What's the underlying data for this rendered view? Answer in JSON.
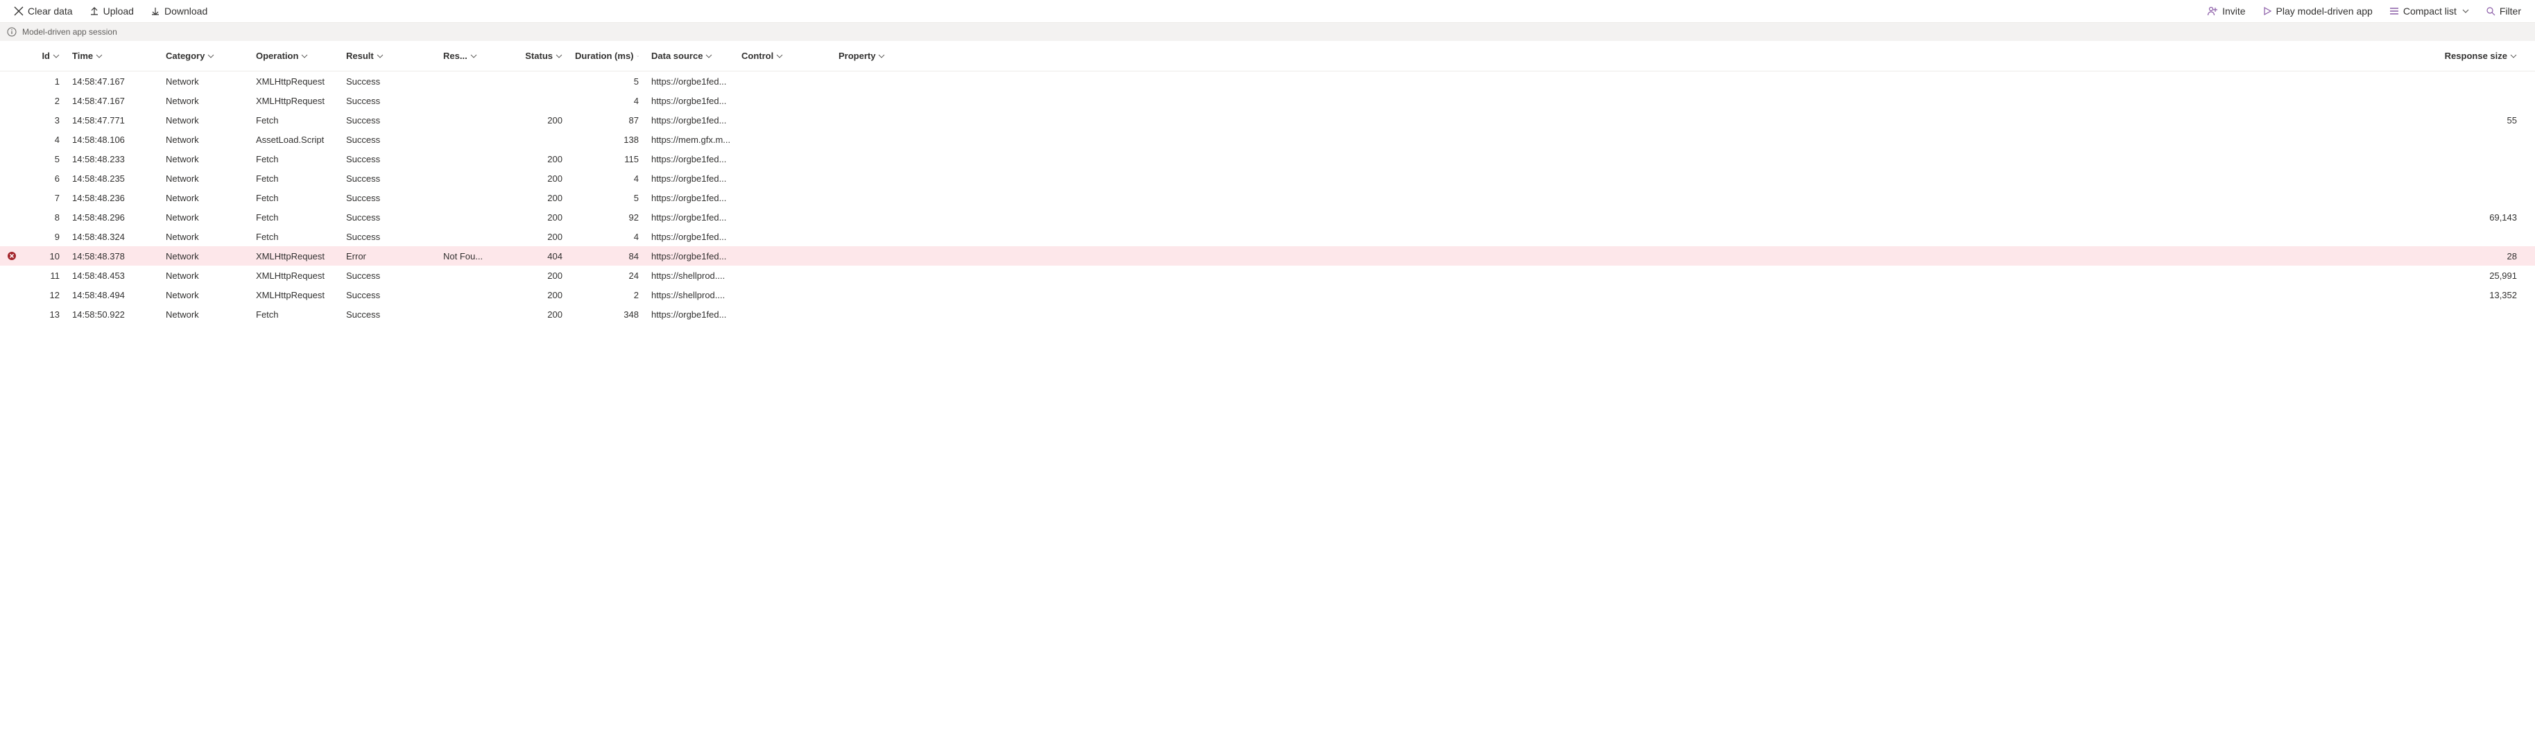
{
  "toolbar": {
    "left": {
      "clear_data": "Clear data",
      "upload": "Upload",
      "download": "Download"
    },
    "right": {
      "invite": "Invite",
      "play": "Play model-driven app",
      "compact_list": "Compact list",
      "filter": "Filter"
    }
  },
  "session_bar": {
    "label": "Model-driven app session"
  },
  "columns": {
    "id": "Id",
    "time": "Time",
    "category": "Category",
    "operation": "Operation",
    "result": "Result",
    "res": "Res...",
    "status": "Status",
    "duration": "Duration (ms)",
    "data_source": "Data source",
    "control": "Control",
    "property": "Property",
    "response_size": "Response size"
  },
  "rows": [
    {
      "id": "1",
      "time": "14:58:47.167",
      "category": "Network",
      "operation": "XMLHttpRequest",
      "result": "Success",
      "res": "",
      "status": "",
      "duration": "5",
      "data_source": "https://orgbe1fed...",
      "control": "",
      "property": "",
      "response_size": "",
      "error": false
    },
    {
      "id": "2",
      "time": "14:58:47.167",
      "category": "Network",
      "operation": "XMLHttpRequest",
      "result": "Success",
      "res": "",
      "status": "",
      "duration": "4",
      "data_source": "https://orgbe1fed...",
      "control": "",
      "property": "",
      "response_size": "",
      "error": false
    },
    {
      "id": "3",
      "time": "14:58:47.771",
      "category": "Network",
      "operation": "Fetch",
      "result": "Success",
      "res": "",
      "status": "200",
      "duration": "87",
      "data_source": "https://orgbe1fed...",
      "control": "",
      "property": "",
      "response_size": "55",
      "error": false
    },
    {
      "id": "4",
      "time": "14:58:48.106",
      "category": "Network",
      "operation": "AssetLoad.Script",
      "result": "Success",
      "res": "",
      "status": "",
      "duration": "138",
      "data_source": "https://mem.gfx.m...",
      "control": "",
      "property": "",
      "response_size": "",
      "error": false
    },
    {
      "id": "5",
      "time": "14:58:48.233",
      "category": "Network",
      "operation": "Fetch",
      "result": "Success",
      "res": "",
      "status": "200",
      "duration": "115",
      "data_source": "https://orgbe1fed...",
      "control": "",
      "property": "",
      "response_size": "",
      "error": false
    },
    {
      "id": "6",
      "time": "14:58:48.235",
      "category": "Network",
      "operation": "Fetch",
      "result": "Success",
      "res": "",
      "status": "200",
      "duration": "4",
      "data_source": "https://orgbe1fed...",
      "control": "",
      "property": "",
      "response_size": "",
      "error": false
    },
    {
      "id": "7",
      "time": "14:58:48.236",
      "category": "Network",
      "operation": "Fetch",
      "result": "Success",
      "res": "",
      "status": "200",
      "duration": "5",
      "data_source": "https://orgbe1fed...",
      "control": "",
      "property": "",
      "response_size": "",
      "error": false
    },
    {
      "id": "8",
      "time": "14:58:48.296",
      "category": "Network",
      "operation": "Fetch",
      "result": "Success",
      "res": "",
      "status": "200",
      "duration": "92",
      "data_source": "https://orgbe1fed...",
      "control": "",
      "property": "",
      "response_size": "69,143",
      "error": false
    },
    {
      "id": "9",
      "time": "14:58:48.324",
      "category": "Network",
      "operation": "Fetch",
      "result": "Success",
      "res": "",
      "status": "200",
      "duration": "4",
      "data_source": "https://orgbe1fed...",
      "control": "",
      "property": "",
      "response_size": "",
      "error": false
    },
    {
      "id": "10",
      "time": "14:58:48.378",
      "category": "Network",
      "operation": "XMLHttpRequest",
      "result": "Error",
      "res": "Not Fou...",
      "status": "404",
      "duration": "84",
      "data_source": "https://orgbe1fed...",
      "control": "",
      "property": "",
      "response_size": "28",
      "error": true
    },
    {
      "id": "11",
      "time": "14:58:48.453",
      "category": "Network",
      "operation": "XMLHttpRequest",
      "result": "Success",
      "res": "",
      "status": "200",
      "duration": "24",
      "data_source": "https://shellprod....",
      "control": "",
      "property": "",
      "response_size": "25,991",
      "error": false
    },
    {
      "id": "12",
      "time": "14:58:48.494",
      "category": "Network",
      "operation": "XMLHttpRequest",
      "result": "Success",
      "res": "",
      "status": "200",
      "duration": "2",
      "data_source": "https://shellprod....",
      "control": "",
      "property": "",
      "response_size": "13,352",
      "error": false
    },
    {
      "id": "13",
      "time": "14:58:50.922",
      "category": "Network",
      "operation": "Fetch",
      "result": "Success",
      "res": "",
      "status": "200",
      "duration": "348",
      "data_source": "https://orgbe1fed...",
      "control": "",
      "property": "",
      "response_size": "",
      "error": false
    }
  ]
}
